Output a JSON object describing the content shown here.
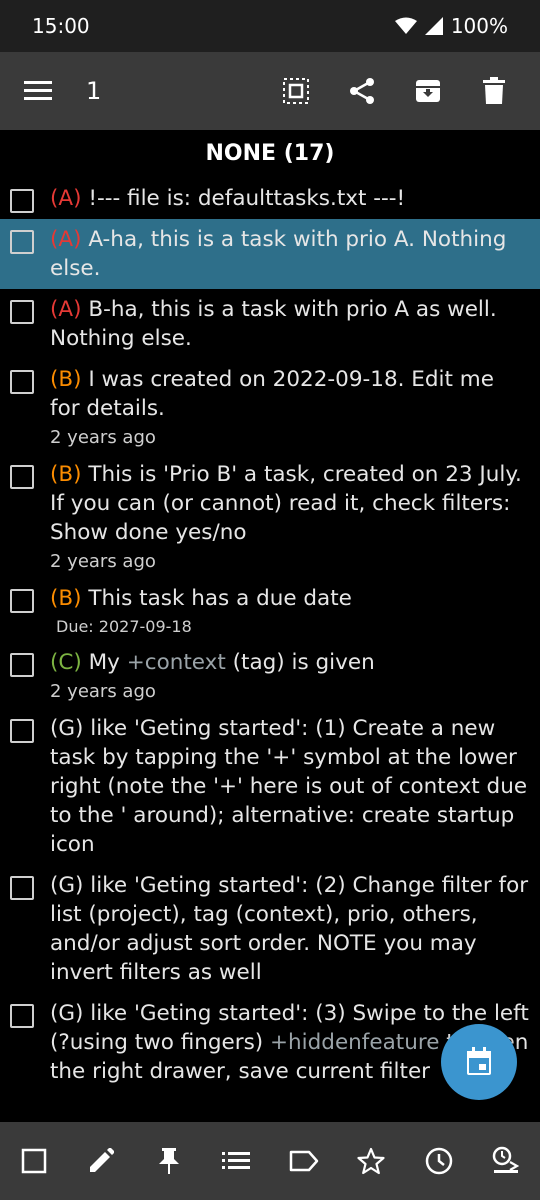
{
  "status": {
    "time": "15:00",
    "battery": "100%"
  },
  "toolbar": {
    "title": "1"
  },
  "section": {
    "header": "NONE (17)"
  },
  "tasks": [
    {
      "prio": "(A)",
      "text": " !--- file is: defaulttasks.txt ---!"
    },
    {
      "prio": "(A)",
      "text": " A-ha, this is a task with prio A. Nothing else."
    },
    {
      "prio": "(A)",
      "text": " B-ha, this is a task with prio A as well. Nothing else."
    },
    {
      "prio": "(B)",
      "text": " I was created on 2022-09-18. Edit me for details.",
      "meta": "2 years ago"
    },
    {
      "prio": "(B)",
      "text": " This is 'Prio B' a task, created on 23 July. If you can (or cannot) read it, check filters: Show done yes/no",
      "meta": "2 years ago"
    },
    {
      "prio": "(B)",
      "text": " This task has a due date",
      "due": "Due: 2027-09-18"
    },
    {
      "prio": "(C)",
      "text_before": " My ",
      "tag": "+context",
      "text_after": " (tag) is given",
      "meta": "2 years ago"
    },
    {
      "prio": "(G)",
      "text": " like 'Geting started': (1) Create a new task by tapping the '+' symbol at the lower right (note the '+' here is out of context due to the ' around); alternative: create startup icon"
    },
    {
      "prio": "(G)",
      "text": " like 'Geting started': (2) Change filter for list (project), tag (context), prio, others, and/or adjust sort order. NOTE you may invert filters as well"
    },
    {
      "prio": "(G)",
      "text_before": " like 'Geting started': (3) Swipe to the left (?using two fingers) ",
      "tag": "+hiddenfeature",
      "text_after": " to open the right drawer, save current filter"
    }
  ],
  "colors": {
    "toolbar": "#3a3a3a",
    "selected_row": "#2e6f8a",
    "fab": "#3b95cf",
    "prio_a": "#e53935",
    "prio_b": "#fb8c00",
    "prio_c": "#7cb342"
  },
  "icons": {
    "toolbar": [
      "menu-icon",
      "select-all-icon",
      "share-icon",
      "archive-icon",
      "delete-icon"
    ],
    "bottom": [
      "checkbox-icon",
      "edit-icon",
      "pin-icon",
      "list-icon",
      "label-icon",
      "star-icon",
      "clock-icon",
      "threshold-icon"
    ],
    "fab": "calendar-icon"
  }
}
